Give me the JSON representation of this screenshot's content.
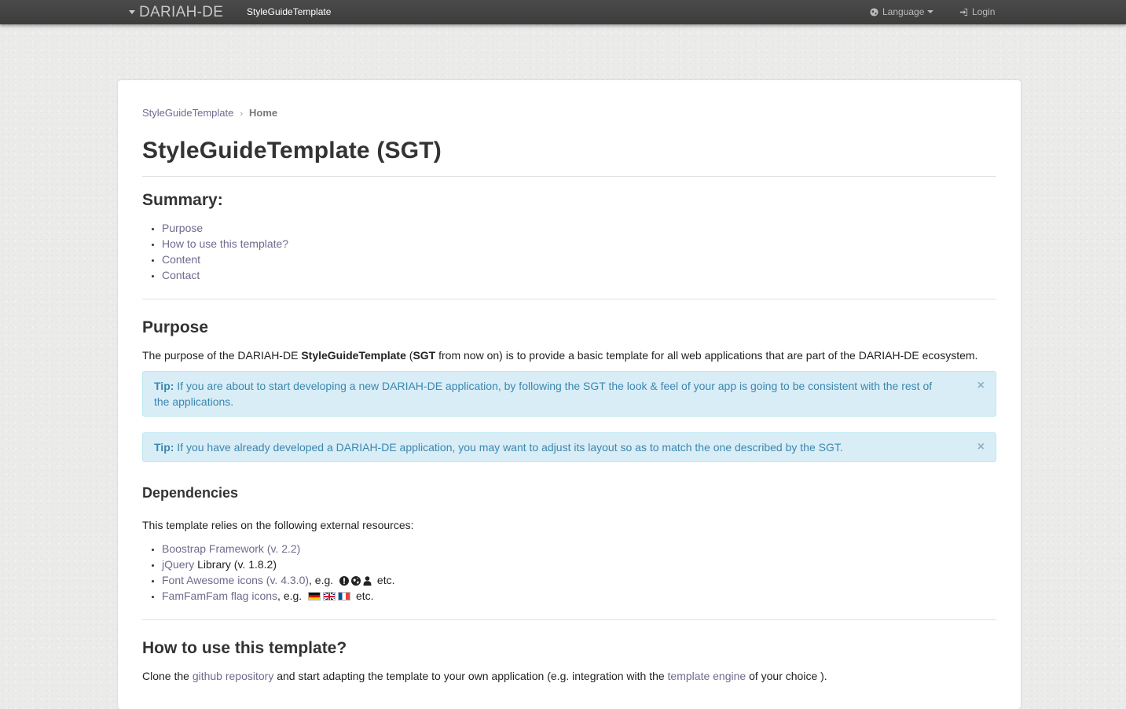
{
  "topbar": {
    "brand": "DARIAH-DE",
    "app_name": "StyleGuideTemplate",
    "language_label": "Language",
    "login_label": "Login"
  },
  "breadcrumb": {
    "root": "StyleGuideTemplate",
    "separator": "›",
    "current": "Home"
  },
  "page_title": "StyleGuideTemplate (SGT)",
  "summary": {
    "heading": "Summary:",
    "items": [
      "Purpose",
      "How to use this template?",
      "Content",
      "Contact"
    ]
  },
  "purpose": {
    "heading": "Purpose",
    "text_1": "The purpose of the DARIAH-DE ",
    "bold_1": "StyleGuideTemplate",
    "text_2": " (",
    "bold_2": "SGT",
    "text_3": " from now on) is to provide a basic template for all web applications that are part of the DARIAH-DE ecosystem.",
    "tip1_label": "Tip:",
    "tip1_text": " If you are about to start developing a new DARIAH-DE application, by following the SGT the look & feel of your app is going to be consistent with the rest of the applications.",
    "tip2_label": "Tip:",
    "tip2_text": " If you have already developed a DARIAH-DE application, you may want to adjust its layout so as to match the one described by the SGT.",
    "close_glyph": "×"
  },
  "dependencies": {
    "heading": "Dependencies",
    "intro": "This template relies on the following external resources:",
    "bootstrap_link": "Boostrap Framework (v. 2.2)",
    "jquery_link": "jQuery",
    "jquery_rest": " Library (v. 1.8.2)",
    "fa_link": "Font Awesome icons (v. 4.3.0)",
    "fa_rest": ", e.g.",
    "fa_icons": [
      "exclamation-circle-icon",
      "globe-icon",
      "user-icon"
    ],
    "fa_etc": " etc.",
    "famfam_link": "FamFamFam flag icons",
    "famfam_rest": ", e.g.",
    "flags": [
      "flag-de-icon",
      "flag-gb-icon",
      "flag-fr-icon"
    ],
    "famfam_etc": " etc."
  },
  "howto": {
    "heading": "How to use this template?",
    "text_1": "Clone the ",
    "link_1": "github repository",
    "text_2": " and start adapting the template to your own application (e.g. integration with the ",
    "link_2": "template engine",
    "text_3": " of your choice )."
  },
  "colors": {
    "topbar": "#444444",
    "link": "#6d6b8e",
    "alert_bg": "#d9edf7",
    "alert_text": "#3a87ad"
  }
}
